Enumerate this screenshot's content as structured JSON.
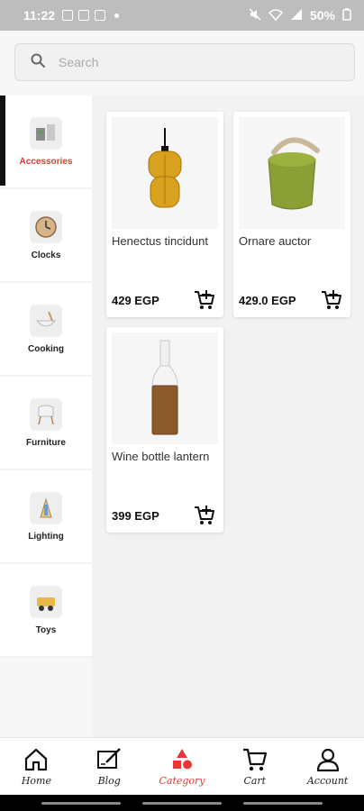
{
  "status_bar": {
    "time": "11:22",
    "battery": "50%"
  },
  "search": {
    "placeholder": "Search"
  },
  "categories": [
    {
      "label": "Accessories",
      "icon": "accessories-icon",
      "active": true
    },
    {
      "label": "Clocks",
      "icon": "clock-icon"
    },
    {
      "label": "Cooking",
      "icon": "cooking-icon"
    },
    {
      "label": "Furniture",
      "icon": "chair-icon"
    },
    {
      "label": "Lighting",
      "icon": "lamp-icon"
    },
    {
      "label": "Toys",
      "icon": "toy-icon"
    }
  ],
  "products": [
    {
      "name": "Henectus tincidunt",
      "price": "429 EGP",
      "icon": "pendant-lamp-icon"
    },
    {
      "name": "Ornare auctor",
      "price": "429.0 EGP",
      "icon": "stool-icon"
    },
    {
      "name": "Wine bottle lantern",
      "price": "399 EGP",
      "icon": "bottle-lantern-icon"
    }
  ],
  "bottom_nav": [
    {
      "label": "Home",
      "icon": "home-icon"
    },
    {
      "label": "Blog",
      "icon": "blog-icon"
    },
    {
      "label": "Category",
      "icon": "category-icon",
      "active": true
    },
    {
      "label": "Cart",
      "icon": "cart-icon"
    },
    {
      "label": "Account",
      "icon": "account-icon"
    }
  ],
  "colors": {
    "accent": "#e53935",
    "active_indicator": "#111111"
  }
}
